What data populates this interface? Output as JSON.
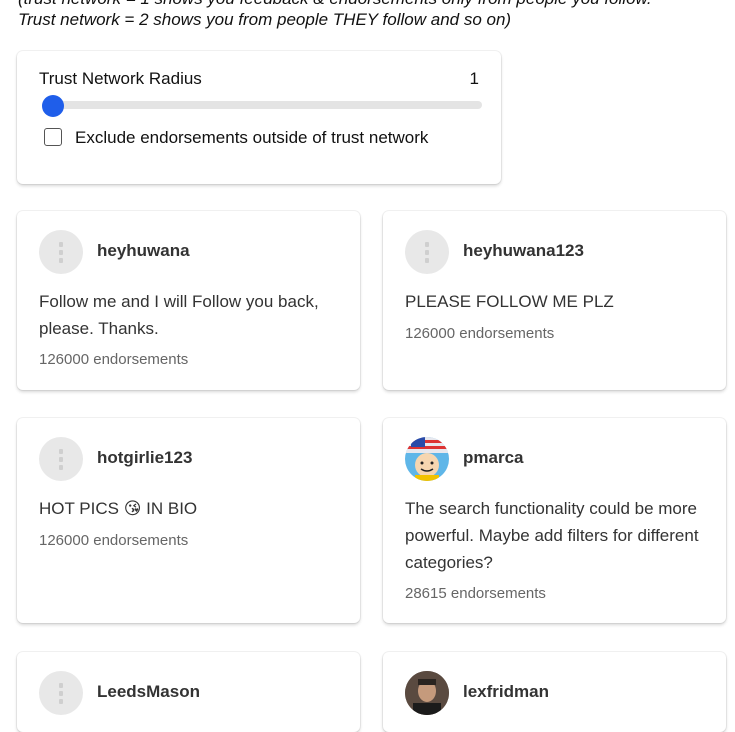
{
  "intro": {
    "line1": "(trust network = 1 shows you feedback & endorsements only from people you follow.",
    "line2": "Trust network = 2 shows you from people THEY follow and so on)"
  },
  "trust": {
    "label": "Trust Network Radius",
    "value": "1",
    "slider_fraction": 0.0,
    "exclude_label": "Exclude endorsements outside of trust network",
    "exclude_checked": false
  },
  "colors": {
    "accent": "#1f5eea"
  },
  "feedback": [
    {
      "username": "heyhuwana",
      "message": "Follow me and I will Follow you back, please. Thanks.",
      "endorsements": "126000 endorsements",
      "avatar": "default-avatar"
    },
    {
      "username": "heyhuwana123",
      "message": "PLEASE FOLLOW ME PLZ",
      "endorsements": "126000 endorsements",
      "avatar": "default-avatar"
    },
    {
      "username": "hotgirlie123",
      "message": "HOT PICS 😘 IN BIO",
      "endorsements": "126000 endorsements",
      "avatar": "default-avatar"
    },
    {
      "username": "pmarca",
      "message": "The search functionality could be more powerful. Maybe add filters for different categories?",
      "endorsements": "28615 endorsements",
      "avatar": "cartoon-flag-avatar"
    },
    {
      "username": "LeedsMason",
      "message": "",
      "endorsements": "",
      "avatar": "default-avatar"
    },
    {
      "username": "lexfridman",
      "message": "",
      "endorsements": "",
      "avatar": "photo-avatar"
    }
  ]
}
